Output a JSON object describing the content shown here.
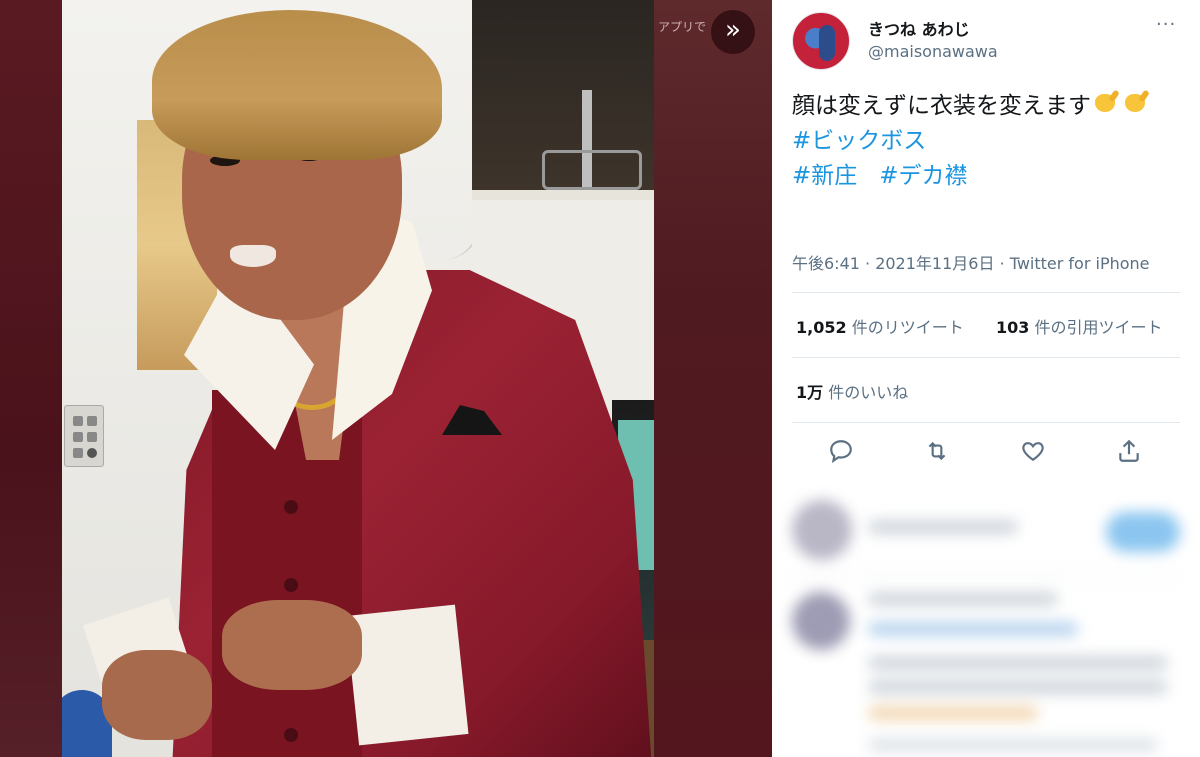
{
  "viewer": {
    "app_label": "アプリで",
    "next_icon": "chevron-double-right-icon",
    "next_glyph": "»"
  },
  "tweet": {
    "display_name": "きつね あわじ",
    "handle": "@maisonawawa",
    "more_glyph": "···",
    "text_main": "顔は変えずに衣装を変えます",
    "hashtags_line1": "#ビックボス",
    "hashtag_a": "#新庄",
    "hashtag_b": "#デカ襟",
    "timestamp": "午後6:41 · 2021年11月6日 · Twitter for iPhone",
    "retweets_count": "1,052",
    "retweets_label": "件のリツイート",
    "quotes_count": "103",
    "quotes_label": "件の引用ツイート",
    "likes_count": "1万",
    "likes_label": "件のいいね",
    "actions": [
      "reply-icon",
      "retweet-icon",
      "like-icon",
      "share-icon"
    ]
  },
  "colors": {
    "accent": "#1b95e0",
    "text": "#14171a",
    "muted": "#5b7083",
    "backdrop": "#5a1b22"
  }
}
